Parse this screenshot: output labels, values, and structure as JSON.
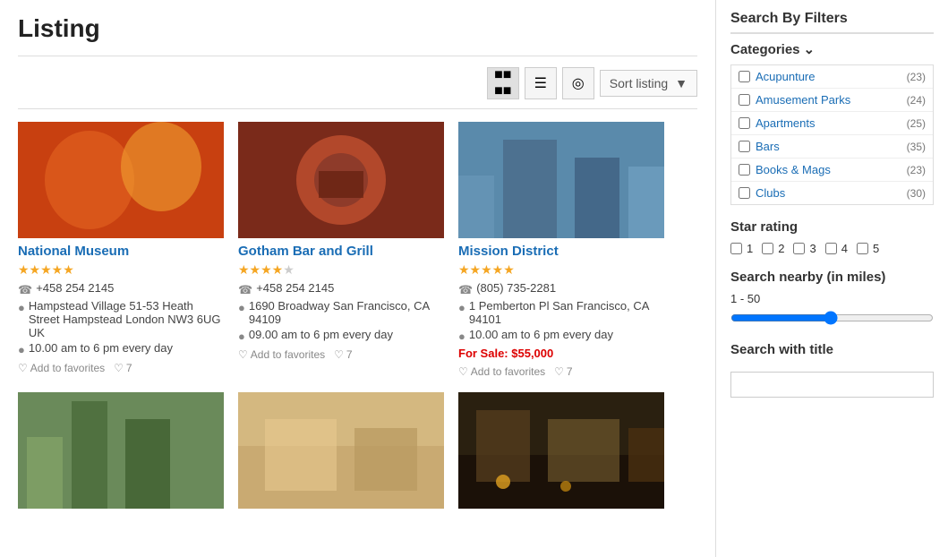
{
  "page": {
    "title": "Listing"
  },
  "toolbar": {
    "sort_label": "Sort listing",
    "view_grid": "⊞",
    "view_list": "☰",
    "view_map": "⚲"
  },
  "listings": [
    {
      "id": 1,
      "title": "National Museum",
      "stars": 5,
      "phone": "+458 254 2145",
      "address": "Hampstead Village 51-53 Heath Street Hampstead London NW3 6UG UK",
      "hours": "10.00 am to 6 pm every day",
      "favorites_label": "Add to favorites",
      "comments": "7",
      "img_class": "img1",
      "for_sale": null
    },
    {
      "id": 2,
      "title": "Gotham Bar and Grill",
      "stars": 4,
      "phone": "+458 254 2145",
      "address": "1690 Broadway San Francisco, CA 94109",
      "hours": "09.00 am to 6 pm every day",
      "favorites_label": "Add to favorites",
      "comments": "7",
      "img_class": "img2",
      "for_sale": null
    },
    {
      "id": 3,
      "title": "Mission District",
      "stars": 5,
      "phone": "(805) 735-2281",
      "address": "1 Pemberton Pl San Francisco, CA 94101",
      "hours": "10.00 am to 6 pm every day",
      "favorites_label": "Add to favorites",
      "comments": "7",
      "img_class": "img3",
      "for_sale": "$55,000"
    }
  ],
  "second_row": [
    {
      "id": 4,
      "img_class": "img4"
    },
    {
      "id": 5,
      "img_class": "img5"
    },
    {
      "id": 6,
      "img_class": "img6"
    }
  ],
  "sidebar": {
    "title": "Search By Filters",
    "categories_label": "Categories",
    "categories": [
      {
        "name": "Acupunture",
        "count": "(23)"
      },
      {
        "name": "Amusement Parks",
        "count": "(24)"
      },
      {
        "name": "Apartments",
        "count": "(25)"
      },
      {
        "name": "Bars",
        "count": "(35)"
      },
      {
        "name": "Books & Mags",
        "count": "(23)"
      },
      {
        "name": "Clubs",
        "count": "(30)"
      }
    ],
    "star_rating_label": "Star rating",
    "star_ratings": [
      "1",
      "2",
      "3",
      "4",
      "5"
    ],
    "nearby_label": "Search nearby (in miles)",
    "range_value": "1 - 50",
    "search_title_label": "Search with title",
    "search_title_placeholder": ""
  }
}
